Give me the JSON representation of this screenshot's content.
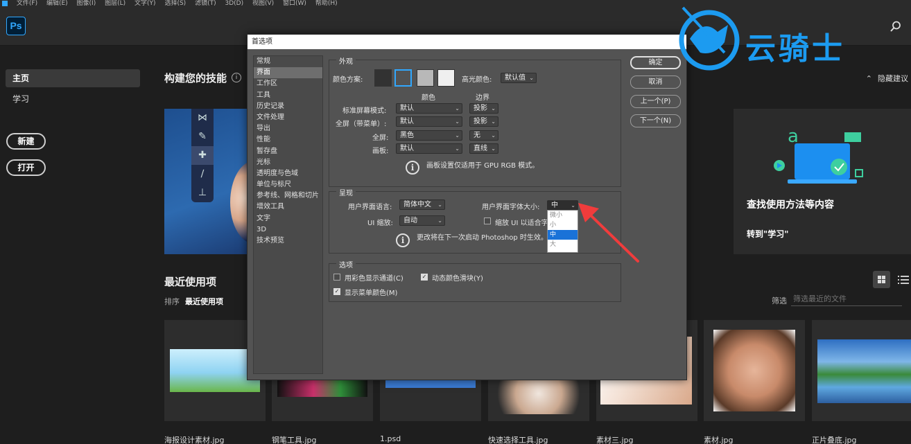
{
  "menubar": {
    "items": [
      "文件(F)",
      "编辑(E)",
      "图像(I)",
      "图层(L)",
      "文字(Y)",
      "选择(S)",
      "滤镜(T)",
      "3D(D)",
      "视图(V)",
      "窗口(W)",
      "帮助(H)"
    ]
  },
  "app": {
    "logo": "Ps"
  },
  "nav": {
    "home": "主页",
    "learn": "学习",
    "new_btn": "新建",
    "open_btn": "打开"
  },
  "main": {
    "skills_title": "构建您的技能",
    "hide_tips": "隐藏建议",
    "help_card_title": "查找使用方法等内容",
    "help_card_link": "转到\"学习\"",
    "recent_title": "最近使用项",
    "sort_label": "排序",
    "sort_value": "最近使用项",
    "filter_label": "筛选",
    "filter_placeholder": "筛选最近的文件",
    "files": [
      "海报设计素材.jpg",
      "钢笔工具.jpg",
      "1.psd",
      "快速选择工具.jpg",
      "素材三.jpg",
      "素材.jpg",
      "正片叠底.jpg"
    ]
  },
  "dialog": {
    "title": "首选项",
    "categories": [
      "常规",
      "界面",
      "工作区",
      "工具",
      "历史记录",
      "文件处理",
      "导出",
      "性能",
      "暂存盘",
      "光标",
      "透明度与色域",
      "单位与标尺",
      "参考线、网格和切片",
      "增效工具",
      "文字",
      "3D",
      "技术预览"
    ],
    "selected_category": "界面",
    "appearance": {
      "title": "外观",
      "color_scheme_label": "颜色方案:",
      "highlight_label": "高光颜色:",
      "highlight_value": "默认值",
      "col_color": "颜色",
      "col_border": "边界",
      "rows": [
        {
          "label": "标准屏幕模式:",
          "color": "默认",
          "border": "投影"
        },
        {
          "label": "全屏（带菜单）:",
          "color": "默认",
          "border": "投影"
        },
        {
          "label": "全屏:",
          "color": "黑色",
          "border": "无"
        },
        {
          "label": "画板:",
          "color": "默认",
          "border": "直线"
        }
      ],
      "note": "画板设置仅适用于 GPU RGB 模式。"
    },
    "presentation": {
      "title": "呈现",
      "lang_label": "用户界面语言:",
      "lang_value": "简体中文",
      "fontsize_label": "用户界面字体大小:",
      "fontsize_value": "中",
      "scale_label": "UI 缩放:",
      "scale_value": "自动",
      "scale_check": "缩放 UI 以适合字",
      "note": "更改将在下一次启动 Photoshop 时生效。",
      "fontsize_options": [
        "微小",
        "小",
        "中",
        "大"
      ],
      "fontsize_selected": "中"
    },
    "options": {
      "title": "选项",
      "show_channels": "用彩色显示通道(C)",
      "dynamic_sliders": "动态颜色滑块(Y)",
      "show_menu_colors": "显示菜单颜色(M)"
    },
    "buttons": {
      "ok": "确定",
      "cancel": "取消",
      "prev": "上一个(P)",
      "next": "下一个(N)"
    }
  },
  "watermark": {
    "text": "云骑士"
  },
  "colors": {
    "accent": "#31a8ff",
    "watermark": "#1c9bf0",
    "arrow": "#f03c3c"
  }
}
